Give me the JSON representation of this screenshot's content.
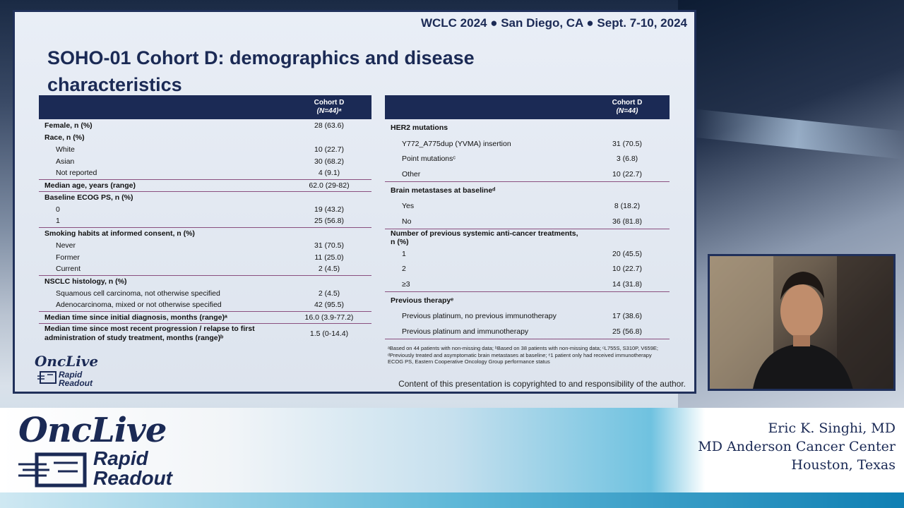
{
  "conference": "WCLC 2024 ● San Diego, CA ● Sept. 7-10, 2024",
  "slide_title": "SOHO-01 Cohort D: demographics and disease characteristics",
  "left_table": {
    "header_line1": "Cohort D",
    "header_line2": "(N=44)ᵃ",
    "rows": [
      {
        "label": "Female, n (%)",
        "value": "28 (63.6)"
      },
      {
        "label": "Race, n (%)",
        "value": ""
      },
      {
        "label": "White",
        "value": "10 (22.7)"
      },
      {
        "label": "Asian",
        "value": "30 (68.2)"
      },
      {
        "label": "Not reported",
        "value": "4 (9.1)"
      },
      {
        "label": "Median age, years (range)",
        "value": "62.0 (29-82)"
      },
      {
        "label": "Baseline ECOG PS, n (%)",
        "value": ""
      },
      {
        "label": "0",
        "value": "19 (43.2)"
      },
      {
        "label": "1",
        "value": "25 (56.8)"
      },
      {
        "label": "Smoking habits at informed consent, n (%)",
        "value": ""
      },
      {
        "label": "Never",
        "value": "31 (70.5)"
      },
      {
        "label": "Former",
        "value": "11 (25.0)"
      },
      {
        "label": "Current",
        "value": "2 (4.5)"
      },
      {
        "label": "NSCLC histology, n (%)",
        "value": ""
      },
      {
        "label": "Squamous cell carcinoma, not otherwise specified",
        "value": "2 (4.5)"
      },
      {
        "label": "Adenocarcinoma, mixed or not otherwise specified",
        "value": "42 (95.5)"
      },
      {
        "label": "Median time since initial diagnosis, months (range)ᵃ",
        "value": "16.0 (3.9-77.2)"
      },
      {
        "label": "Median time since most recent progression / relapse to first administration of study treatment, months (range)ᵇ",
        "value": "1.5 (0-14.4)"
      }
    ]
  },
  "right_table": {
    "header_line1": "Cohort D",
    "header_line2": "(N=44)",
    "rows": [
      {
        "label": "HER2 mutations",
        "value": ""
      },
      {
        "label": "Y772_A775dup (YVMA) insertion",
        "value": "31 (70.5)"
      },
      {
        "label": "Point mutationsᶜ",
        "value": "3 (6.8)"
      },
      {
        "label": "Other",
        "value": "10 (22.7)"
      },
      {
        "label": "Brain metastases at baselineᵈ",
        "value": ""
      },
      {
        "label": "Yes",
        "value": "8 (18.2)"
      },
      {
        "label": "No",
        "value": "36 (81.8)"
      },
      {
        "label": "Number of previous systemic anti-cancer treatments, n (%)",
        "value": ""
      },
      {
        "label": "1",
        "value": "20 (45.5)"
      },
      {
        "label": "2",
        "value": "10 (22.7)"
      },
      {
        "label": "≥3",
        "value": "14 (31.8)"
      },
      {
        "label": "Previous therapyᵉ",
        "value": ""
      },
      {
        "label": "Previous platinum, no previous immunotherapy",
        "value": "17 (38.6)"
      },
      {
        "label": "Previous platinum and immunotherapy",
        "value": "25 (56.8)"
      }
    ]
  },
  "footnote_1": "ᵃBased on 44 patients with non-missing data; ᵇBased on 38 patients with non-missing data; ᶜL755S, S310P, V659E; ᵈPreviously treated and asymptomatic brain metastases at baseline; ᵉ1 patient only had received immunotherapy",
  "footnote_2": "ECOG PS, Eastern Cooperative Oncology Group performance status",
  "copyright": "Content of this presentation is copyrighted to and responsibility of the author.",
  "logo": {
    "onc": "OncLive",
    "rapid": "Rapid",
    "readout": "Readout"
  },
  "speaker": {
    "name": "Eric K. Singhi, MD",
    "institution": "MD Anderson Cancer Center",
    "location": "Houston, Texas"
  },
  "colors": {
    "navy": "#1b2a55",
    "divider": "#8a4f7f"
  }
}
